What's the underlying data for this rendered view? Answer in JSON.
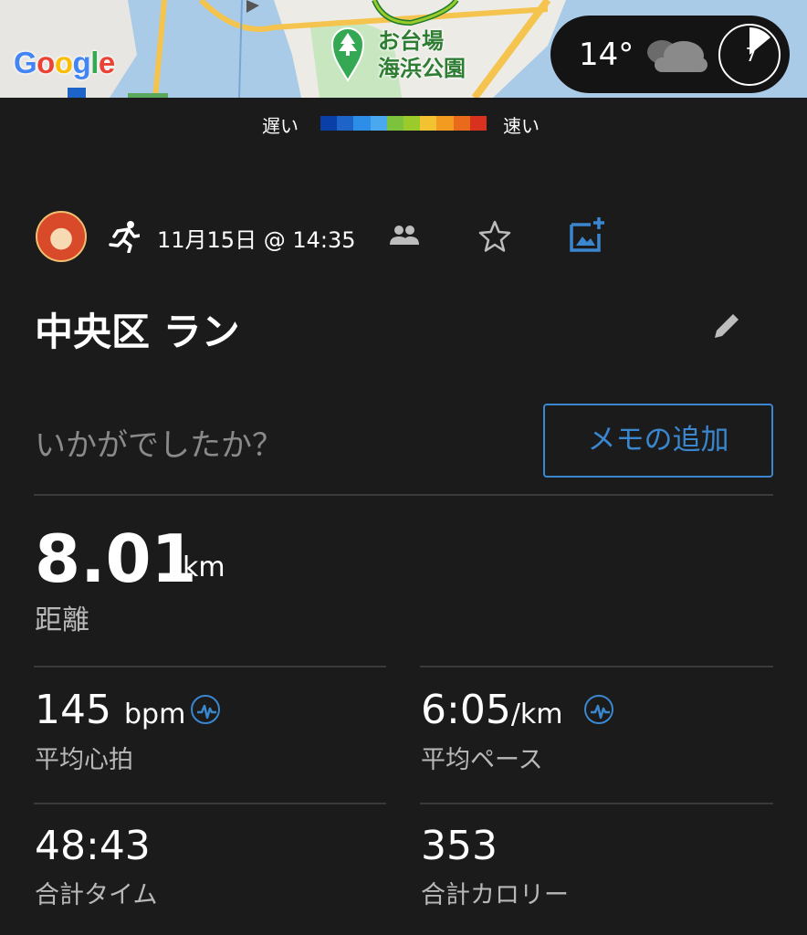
{
  "map": {
    "provider": "Google",
    "park_label_line1": "お台場",
    "park_label_line2": "海浜公園"
  },
  "weather": {
    "temperature": "14°",
    "condition_icon": "cloud-icon",
    "uv_index": "7"
  },
  "legend": {
    "slow_label": "遅い",
    "fast_label": "速い",
    "colors": [
      "#0a3fa8",
      "#1e64c8",
      "#2c8ee6",
      "#4aa8ee",
      "#7cc23c",
      "#9acb2a",
      "#f2c230",
      "#f39a20",
      "#ea6a1c",
      "#d8321e"
    ]
  },
  "activity": {
    "type_icon": "running-icon",
    "date": "11月15日 @ 14:35",
    "title": "中央区 ラン",
    "prompt": "いかがでしたか？",
    "memo_button": "メモの追加"
  },
  "stats": {
    "distance": {
      "value": "8.01",
      "unit": "km",
      "label": "距離"
    },
    "heart_rate": {
      "value": "145",
      "unit": "bpm",
      "label": "平均心拍"
    },
    "pace": {
      "value": "6:05",
      "unit": "/km",
      "label": "平均ペース"
    },
    "time": {
      "value": "48:43",
      "label": "合計タイム"
    },
    "calories": {
      "value": "353",
      "label": "合計カロリー"
    }
  },
  "colors": {
    "background": "#1b1b1b",
    "accent": "#3a87d0",
    "secondary_text": "#b8b8b8"
  }
}
